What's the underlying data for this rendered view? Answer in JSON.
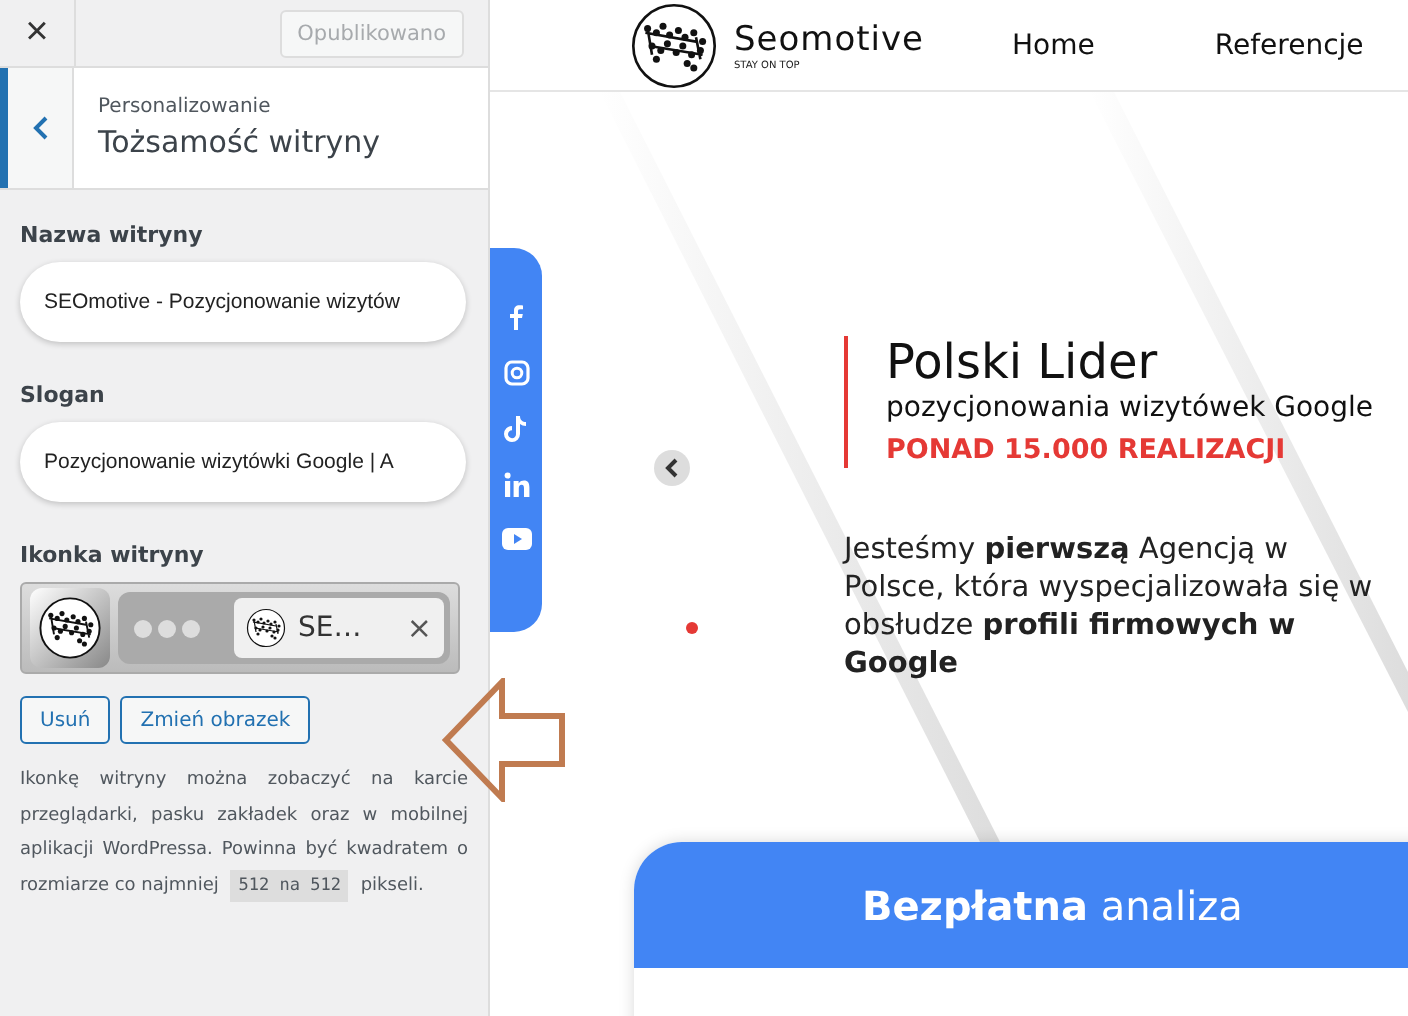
{
  "sidebar": {
    "close_label": "×",
    "publish_button": {
      "label": "Opublikowano",
      "disabled": true
    },
    "breadcrumb": "Personalizowanie",
    "title": "Tożsamość witryny",
    "fields": [
      {
        "label": "Nazwa witryny",
        "value": "SEOmotive - Pozycjonowanie wizytów"
      },
      {
        "label": "Slogan",
        "value": "Pozycjonowanie wizytówki Google | A"
      }
    ],
    "site_icon": {
      "label": "Ikonka witryny",
      "tab_title": "SE…",
      "tab_close": "×"
    },
    "buttons": [
      "Usuń",
      "Zmień obrazek"
    ],
    "help": {
      "before": "Ikonkę witryny można zobaczyć na karcie przeglądarki, pasku zakładek oraz w mobilnej aplikacji WordPressa. Powinna być kwadratem o rozmiarze co najmniej",
      "code": "512 na 512",
      "after": "pikseli."
    }
  },
  "preview": {
    "logo": {
      "name": "Seomotive",
      "tagline": "STAY ON TOP"
    },
    "nav": [
      "Home",
      "Referencje"
    ],
    "hero": {
      "title": "Polski Lider",
      "subtitle": "pozycjonowania wizytówek Google",
      "highlight": "PONAD 15.000 REALIZACJI",
      "body": "Jesteśmy **pierwszą** Agencją w Polsce, która wyspecjalizowała się w obsłudze **profili firmowych w Google**"
    },
    "card_title": "**Bezpłatna** analiza"
  }
}
